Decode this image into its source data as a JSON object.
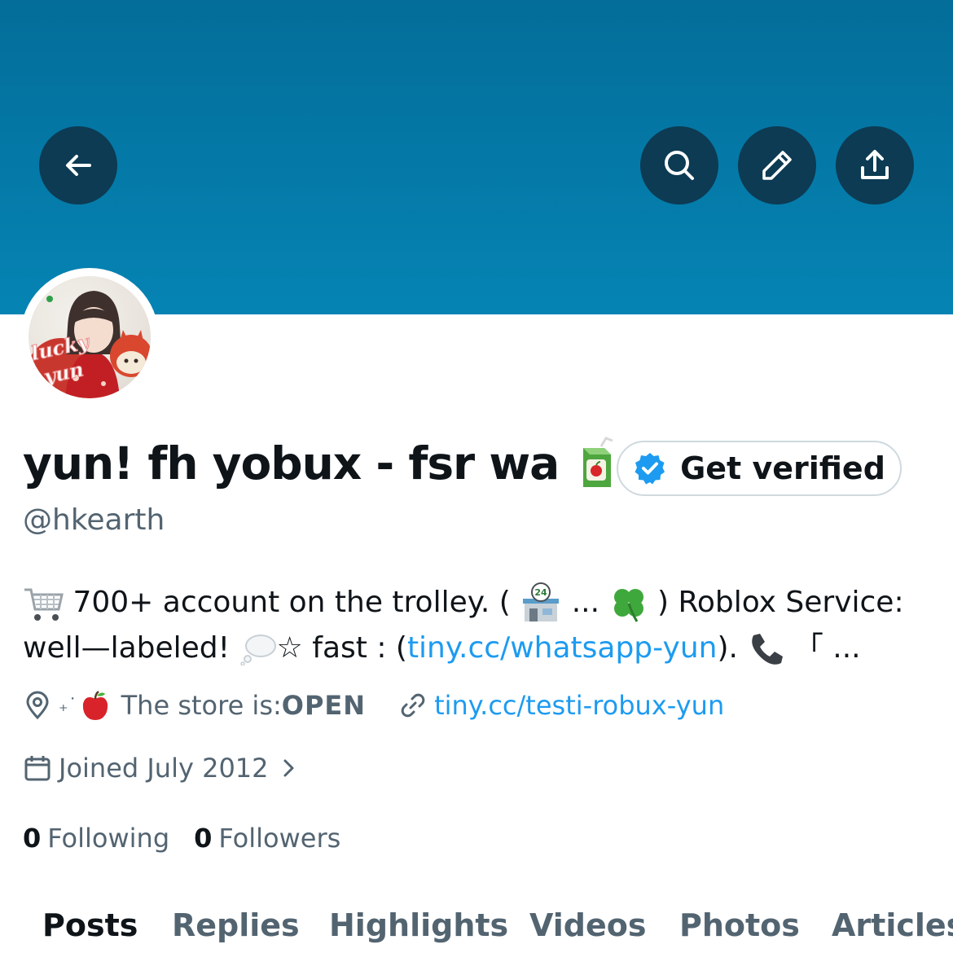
{
  "header": {
    "icons": [
      "back-arrow-icon",
      "search-icon",
      "pencil-icon",
      "share-icon"
    ],
    "banner_color": "#0584b4",
    "button_color": "#0c3b53"
  },
  "profile": {
    "avatar_text": [
      "lucky",
      "yun"
    ],
    "display_name": "yun! fh yobux - fsr wa",
    "handle": "@hkearth",
    "verify_label": "Get verified"
  },
  "bio": {
    "part1": " 700+ account on the trolley. ( ",
    "ellipsis": " ... ",
    "part2": " ) Roblox Service: well—labeled! ",
    "part3": "☆ fast : (",
    "link": "tiny.cc/whatsapp-yun",
    "part4": "). ",
    "part5": " 「 ..."
  },
  "meta": {
    "location_prefix": "₊˙",
    "location_text": "The store is: ",
    "location_status": "OPEN",
    "website": "tiny.cc/testi-robux-yun",
    "joined": "Joined July 2012"
  },
  "stats": {
    "following_count": "0",
    "following_label": "Following",
    "followers_count": "0",
    "followers_label": "Followers"
  },
  "tabs": [
    "Posts",
    "Replies",
    "Highlights",
    "Videos",
    "Photos",
    "Articles"
  ],
  "active_tab": "Posts",
  "colors": {
    "link": "#1d9bf0",
    "secondary_text": "#536471",
    "primary_text": "#0f1419"
  }
}
